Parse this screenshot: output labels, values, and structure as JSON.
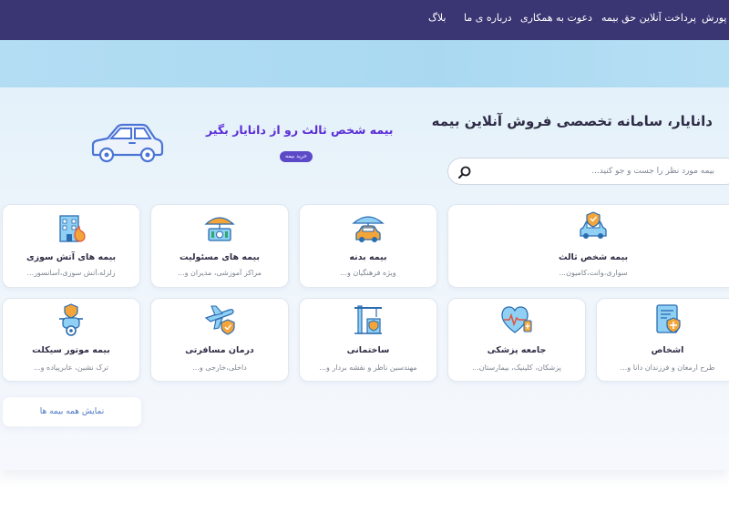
{
  "nav": {
    "items": [
      "پورش",
      "پرداخت آنلاین حق بیمه",
      "دعوت به همکاری",
      "درباره ی ما",
      "بلاگ"
    ]
  },
  "hero": {
    "title": "دانایار، سامانه تخصصی فروش آنلاین بیمه",
    "search_placeholder": "بیمه مورد نظر را جست و جو کنید...",
    "promo_title": "بیمه شخص ثالث رو از دانایار بگیر",
    "promo_button": "خرید بیمه",
    "car_icon": "car-outline-icon"
  },
  "categories": [
    {
      "title": "بیمه شخص ثالث",
      "subtitle": "سواری،وانت،کامیون...",
      "icon": "car-shield-icon"
    },
    {
      "title": "بیمه بدنه",
      "subtitle": "ویژه فرهنگیان و...",
      "icon": "car-umbrella-icon"
    },
    {
      "title": "بیمه های مسئولیت",
      "subtitle": "مراکز آموزشی، مدیران و...",
      "icon": "money-umbrella-icon"
    },
    {
      "title": "بیمه های آتش سوزی",
      "subtitle": "زلزله،آتش سوزی،آسانسور...",
      "icon": "building-fire-icon"
    },
    {
      "title": "اشخاص",
      "subtitle": "طرح ارمغان و فرزندان دانا و...",
      "icon": "document-shield-icon"
    },
    {
      "title": "جامعه پزشکی",
      "subtitle": "پزشکان، کلینیک، بیمارستان...",
      "icon": "heart-monitor-icon"
    },
    {
      "title": "ساختمانی",
      "subtitle": "مهندسین ناظر و نقشه بردار و...",
      "icon": "crane-icon"
    },
    {
      "title": "درمان مسافرتی",
      "subtitle": "داخلی،خارجی و...",
      "icon": "plane-shield-icon"
    },
    {
      "title": "بیمه موتور سیکلت",
      "subtitle": "ترک نشین، عابرپیاده و...",
      "icon": "scooter-icon"
    }
  ],
  "show_all": "نمایش همه بیمه ها",
  "colors": {
    "nav_bg": "#3a3573",
    "accent_purple": "#5b2dd6",
    "icon_blue": "#3aa0e0",
    "icon_orange": "#f4a53a"
  }
}
